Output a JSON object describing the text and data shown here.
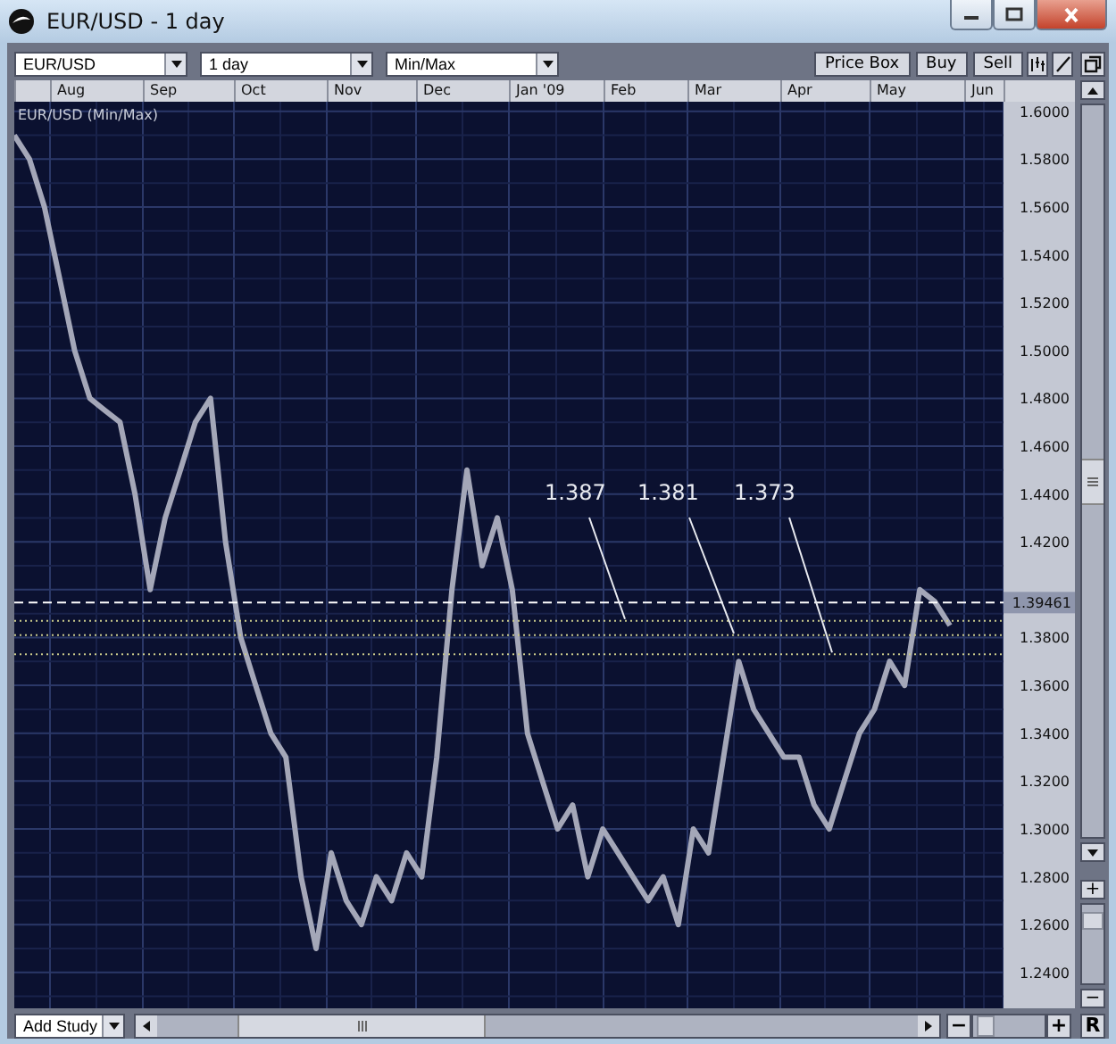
{
  "window": {
    "title": "EUR/USD - 1 day"
  },
  "toolbar": {
    "dropdowns": [
      {
        "value": "EUR/USD"
      },
      {
        "value": "1 day"
      },
      {
        "value": "Min/Max"
      }
    ],
    "buttons": [
      "Price Box",
      "Buy",
      "Sell"
    ]
  },
  "months": [
    "Aug",
    "Sep",
    "Oct",
    "Nov",
    "Dec",
    "Jan '09",
    "Feb",
    "Mar",
    "Apr",
    "May",
    "Jun"
  ],
  "chart": {
    "chart_data": {
      "type": "line",
      "title": "EUR/USD (Min/Max)",
      "grid": true,
      "series": [
        {
          "color": "#a4a7b8",
          "values": [
            1.59,
            1.58,
            1.56,
            1.53,
            1.5,
            1.48,
            1.475,
            1.47,
            1.44,
            1.4,
            1.43,
            1.45,
            1.47,
            1.48,
            1.42,
            1.38,
            1.36,
            1.34,
            1.33,
            1.28,
            1.25,
            1.29,
            1.27,
            1.26,
            1.28,
            1.27,
            1.29,
            1.28,
            1.33,
            1.4,
            1.45,
            1.41,
            1.43,
            1.4,
            1.34,
            1.32,
            1.3,
            1.31,
            1.28,
            1.3,
            1.29,
            1.28,
            1.27,
            1.28,
            1.26,
            1.3,
            1.29,
            1.33,
            1.37,
            1.35,
            1.34,
            1.33,
            1.33,
            1.31,
            1.3,
            1.32,
            1.34,
            1.35,
            1.37,
            1.36,
            1.4,
            1.395,
            1.385
          ]
        }
      ],
      "ylim": [
        1.225,
        1.604
      ],
      "yticks": [
        {
          "value": 1.6,
          "label": "1.6000"
        },
        {
          "value": 1.58,
          "label": "1.5800"
        },
        {
          "value": 1.56,
          "label": "1.5600"
        },
        {
          "value": 1.54,
          "label": "1.5400"
        },
        {
          "value": 1.52,
          "label": "1.5200"
        },
        {
          "value": 1.5,
          "label": "1.5000"
        },
        {
          "value": 1.48,
          "label": "1.4800"
        },
        {
          "value": 1.46,
          "label": "1.4600"
        },
        {
          "value": 1.44,
          "label": "1.4400"
        },
        {
          "value": 1.42,
          "label": "1.4200"
        },
        {
          "value": 1.38,
          "label": "1.3800"
        },
        {
          "value": 1.36,
          "label": "1.3600"
        },
        {
          "value": 1.34,
          "label": "1.3400"
        },
        {
          "value": 1.32,
          "label": "1.3200"
        },
        {
          "value": 1.3,
          "label": "1.3000"
        },
        {
          "value": 1.28,
          "label": "1.2800"
        },
        {
          "value": 1.26,
          "label": "1.2600"
        },
        {
          "value": 1.24,
          "label": "1.2400"
        }
      ],
      "ref_lines": [
        {
          "axis": "y",
          "value": 1.39461,
          "label": "1.39461"
        },
        {
          "axis": "y",
          "value": 1.387,
          "label": "1.387"
        },
        {
          "axis": "y",
          "value": 1.381,
          "label": "1.381"
        },
        {
          "axis": "y",
          "value": 1.373,
          "label": "1.373"
        }
      ]
    }
  },
  "bottom": {
    "study": {
      "value": "Add Study"
    },
    "zoom_minus": "−",
    "zoom_plus": "+",
    "reset": "R"
  },
  "side": {
    "zoom_plus": "+",
    "zoom_minus": "−"
  }
}
